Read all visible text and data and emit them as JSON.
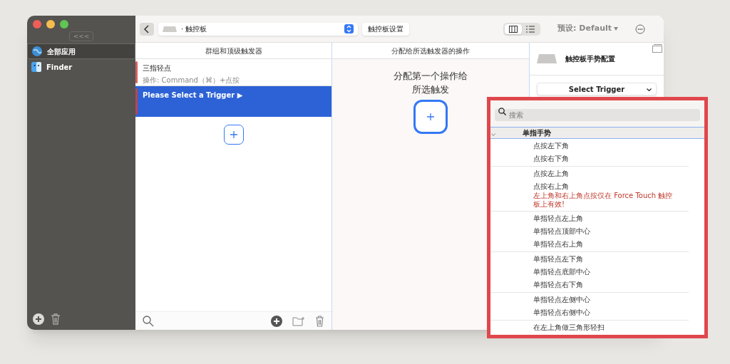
{
  "sidebar": {
    "collapse_label": "<<<",
    "apps": [
      {
        "name": "全部应用",
        "kind": "globe",
        "selected": true
      },
      {
        "name": "Finder",
        "kind": "finder",
        "selected": false
      }
    ]
  },
  "toolbar": {
    "device": "· 触控板",
    "settings_button": "触控板设置",
    "view_modes": [
      {
        "kind": "columns",
        "selected": true
      },
      {
        "kind": "list",
        "selected": false
      }
    ],
    "preset": "预设: Default"
  },
  "triggers": {
    "header": "群组和顶级触发器",
    "items": [
      {
        "title": "三指轻点",
        "subtitle": "操作: Command（⌘）+点按",
        "selected": false
      },
      {
        "title": "Please Select a Trigger ▶",
        "selected": true
      }
    ]
  },
  "actions": {
    "header": "分配给所选触发器的操作",
    "empty_text": "分配第一个操作给所选触发"
  },
  "config": {
    "title": "触控板手势配置",
    "select": "Select Trigger"
  },
  "popover": {
    "search_placeholder": "搜索",
    "group": {
      "title": "单指手势",
      "expanded": true,
      "sections": [
        [
          {
            "label": "点按左下角"
          },
          {
            "label": "点按右下角"
          }
        ],
        [
          {
            "label": "点按左上角"
          },
          {
            "label": "点按右上角",
            "note": "左上角和右上角点按仅在 Force Touch 触控板上有效!"
          }
        ],
        [
          {
            "label": "单指轻点左上角"
          },
          {
            "label": "单指轻点顶部中心"
          },
          {
            "label": "单指轻点右上角"
          }
        ],
        [
          {
            "label": "单指轻点左下角"
          },
          {
            "label": "单指轻点底部中心"
          },
          {
            "label": "单指轻点右下角"
          }
        ],
        [
          {
            "label": "单指轻点左侧中心"
          },
          {
            "label": "单指轻点右侧中心"
          }
        ],
        [
          {
            "label": "在左上角做三角形轻扫"
          }
        ]
      ]
    }
  }
}
